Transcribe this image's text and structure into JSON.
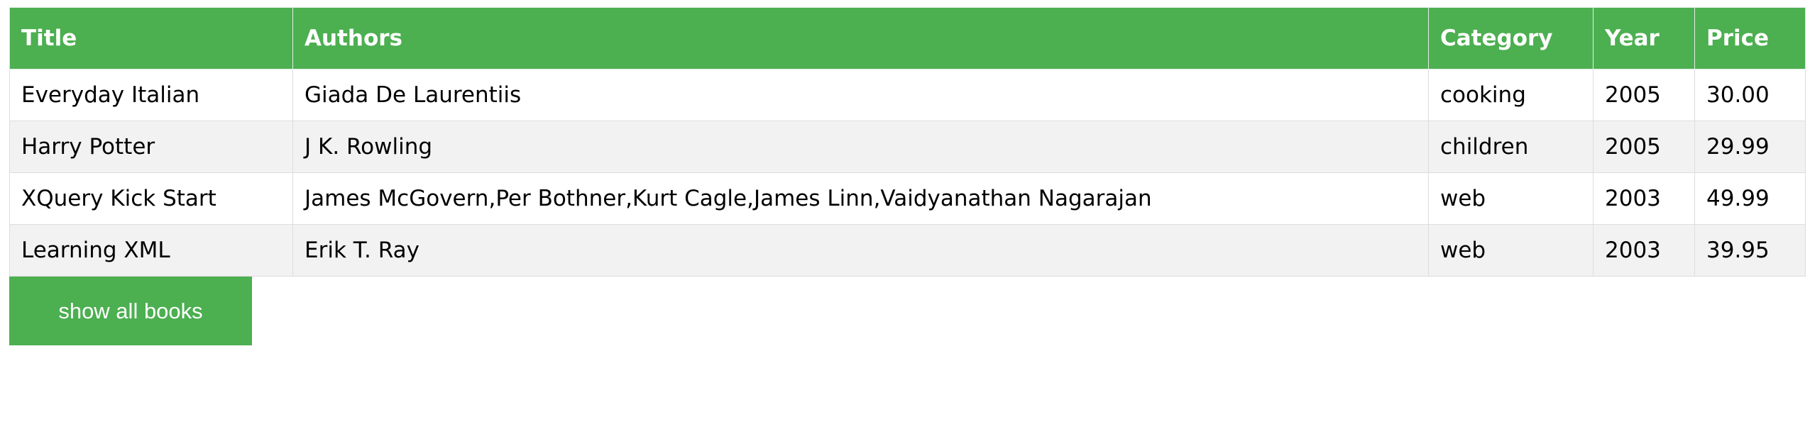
{
  "colors": {
    "header_bg": "#4caf50",
    "button_bg": "#4caf50",
    "row_alt_bg": "#f2f2f2"
  },
  "table": {
    "columns": [
      "Title",
      "Authors",
      "Category",
      "Year",
      "Price"
    ],
    "rows": [
      [
        "Everyday Italian",
        "Giada De Laurentiis",
        "cooking",
        "2005",
        "30.00"
      ],
      [
        "Harry Potter",
        "J K. Rowling",
        "children",
        "2005",
        "29.99"
      ],
      [
        "XQuery Kick Start",
        "James McGovern,Per Bothner,Kurt Cagle,James Linn,Vaidyanathan Nagarajan",
        "web",
        "2003",
        "49.99"
      ],
      [
        "Learning XML",
        "Erik T. Ray",
        "web",
        "2003",
        "39.95"
      ]
    ]
  },
  "actions": {
    "show_all_label": "show all books"
  }
}
